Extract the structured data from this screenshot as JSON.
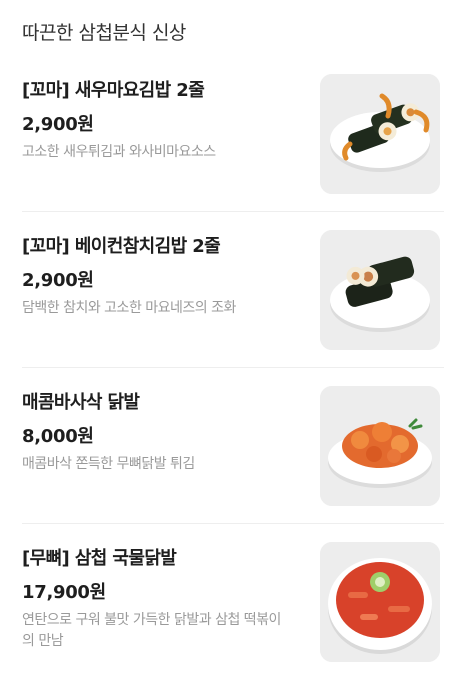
{
  "section": {
    "title": "따끈한 삼첩분식 신상"
  },
  "menu": [
    {
      "name": "[꼬마] 새우마요김밥 2줄",
      "price": "2,900원",
      "desc": "고소한 새우튀김과 와사비마요소스",
      "image_icon": "shrimp-mayo-gimbap-image"
    },
    {
      "name": "[꼬마] 베이컨참치김밥 2줄",
      "price": "2,900원",
      "desc": "담백한 참치와 고소한 마요네즈의 조화",
      "image_icon": "bacon-tuna-gimbap-image"
    },
    {
      "name": "매콤바사삭 닭발",
      "price": "8,000원",
      "desc": "매콤바삭 쫀득한 무뼈닭발 튀김",
      "image_icon": "fried-chicken-feet-image"
    },
    {
      "name": "[무뼈] 삼첩 국물닭발",
      "price": "17,900원",
      "desc": "연탄으로 구워 불맛 가득한 닭발과 삼첩 떡볶이의 만남",
      "image_icon": "soup-chicken-feet-image"
    }
  ]
}
